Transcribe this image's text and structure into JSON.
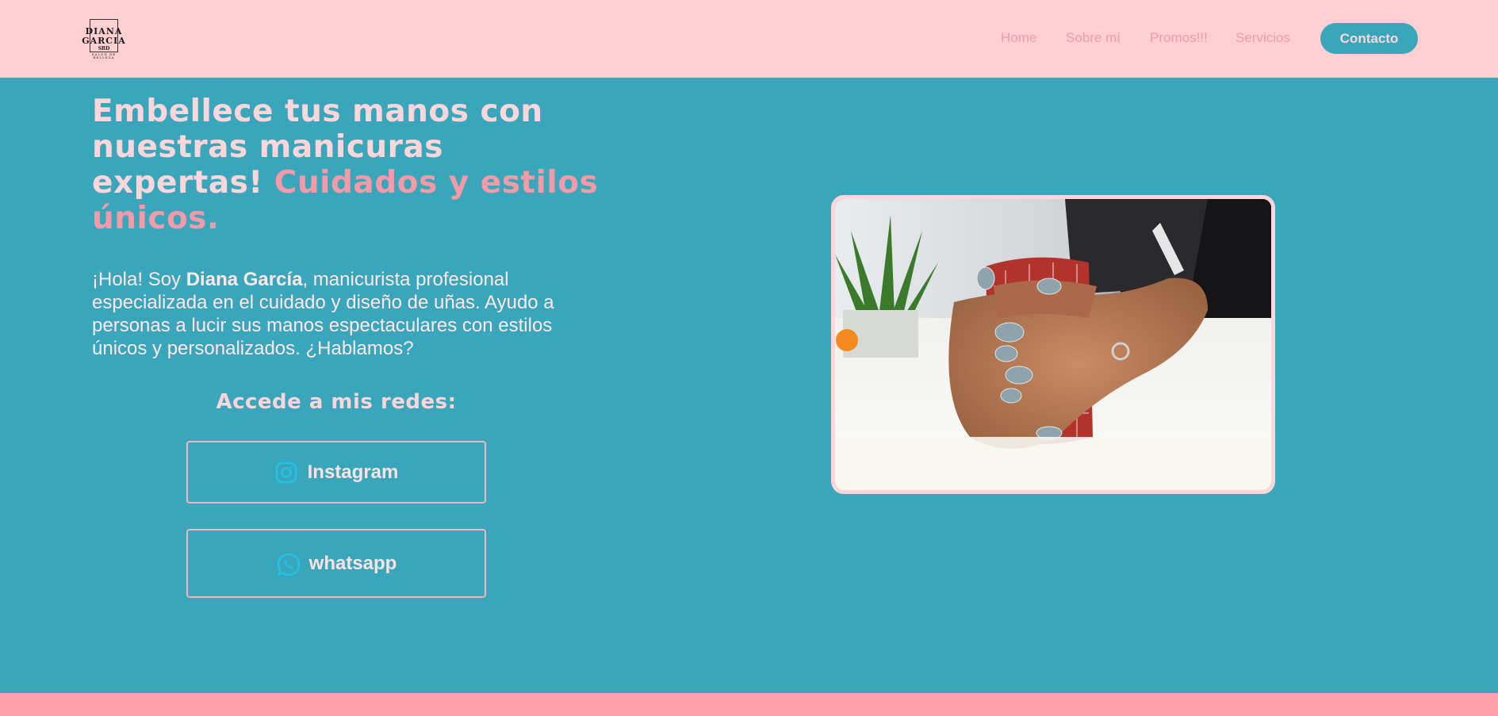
{
  "logo": {
    "line1": "DIANA",
    "line2": "GARCIA",
    "line3": "SBD",
    "line4": "SALON DE BELLEZA"
  },
  "nav": {
    "home": "Home",
    "about": "Sobre mí",
    "promos": "Promos!!!",
    "services": "Servicios",
    "contact": "Contacto"
  },
  "hero": {
    "headline_main": "Embellece tus manos con nuestras manicuras expertas!",
    "headline_accent": "Cuidados y estilos únicos.",
    "intro_before": "¡Hola! Soy ",
    "intro_name": "Diana García",
    "intro_after": ", manicurista profesional especializada en el cuidado y diseño de uñas. Ayudo a personas a lucir sus manos espectaculares con estilos únicos y personalizados. ¿Hablamos?",
    "social_title": "Accede a mis redes:",
    "instagram_label": "Instagram",
    "whatsapp_label": "whatsapp",
    "image_icon": "manicured-hands-holding-mug-photo"
  },
  "colors": {
    "header_bg": "#ffd0d3",
    "main_bg": "#39a6bb",
    "accent_pink": "#f59aa7",
    "footer_band": "#ffa1ab",
    "icon_cyan": "#22c3e6"
  }
}
